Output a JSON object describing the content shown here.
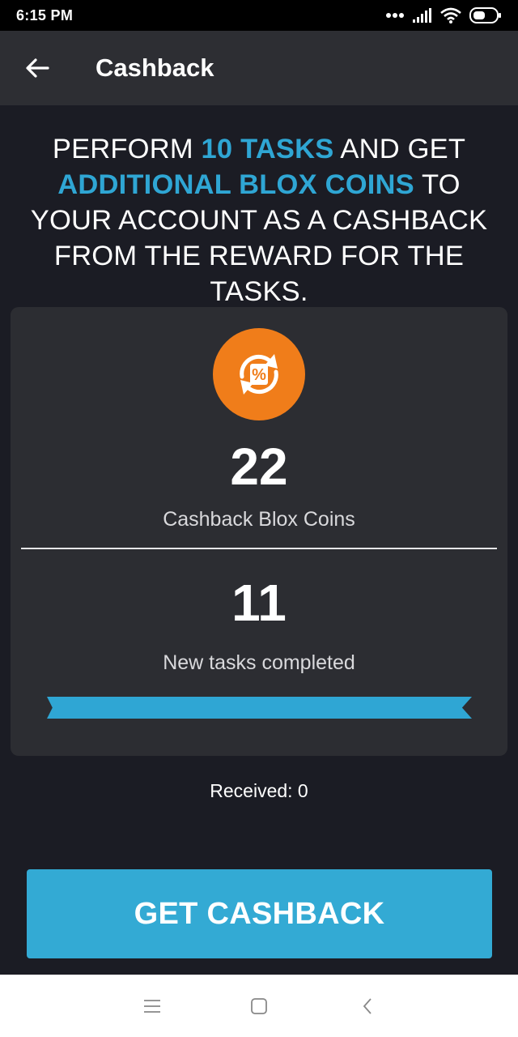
{
  "status_bar": {
    "time": "6:15 PM",
    "icons": [
      "dots-icon",
      "signal-icon",
      "wifi-icon",
      "battery-icon"
    ]
  },
  "app_bar": {
    "back_icon": "arrow-left-icon",
    "title": "Cashback"
  },
  "headline": {
    "part1": "PERFORM ",
    "highlight1": "10 TASKS",
    "part2": " AND GET ",
    "highlight2": "ADDITIONAL BLOX COINS",
    "part3": " TO YOUR ACCOUNT AS A CASHBACK FROM THE REWARD FOR THE TASKS."
  },
  "card": {
    "icon": "percent-cycle-icon",
    "coins_value": "22",
    "coins_label": "Cashback Blox Coins",
    "tasks_value": "11",
    "tasks_label": "New tasks completed",
    "progress_fraction": 1.0
  },
  "received_text": "Received: 0",
  "cta_label": "GET CASHBACK",
  "colors": {
    "accent": "#2fa6d4",
    "badge": "#f07d1a",
    "background": "#1b1c24",
    "card": "#2c2d32"
  },
  "nav_bar": {
    "icons": [
      "menu-icon",
      "home-square-icon",
      "back-chevron-icon"
    ]
  }
}
